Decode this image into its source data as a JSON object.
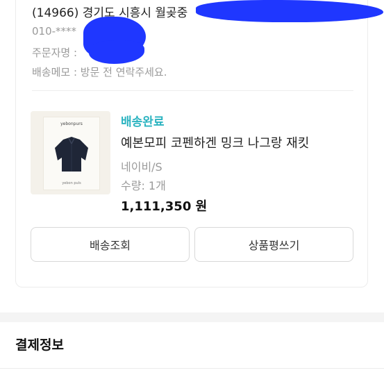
{
  "address": {
    "line": "(14966) 경기도 시흥시 월곶중",
    "phone": "010-****",
    "orderer_label": "주문자명 : ",
    "memo": "배송메모 : 방문 전 연락주세요."
  },
  "product": {
    "status": "배송완료",
    "name": "예본모피 코펜하겐 밍크 나그랑 재킷",
    "option": "네이비/S",
    "quantity": "수량: 1개",
    "price": "1,111,350 원",
    "thumb_brand": "yebonpurs",
    "thumb_caption": "yebon puls"
  },
  "buttons": {
    "track": "배송조회",
    "review": "상품평쓰기"
  },
  "payment": {
    "title": "결제정보"
  },
  "colors": {
    "status": "#2bb3c0",
    "redaction": "#1f37ff"
  }
}
